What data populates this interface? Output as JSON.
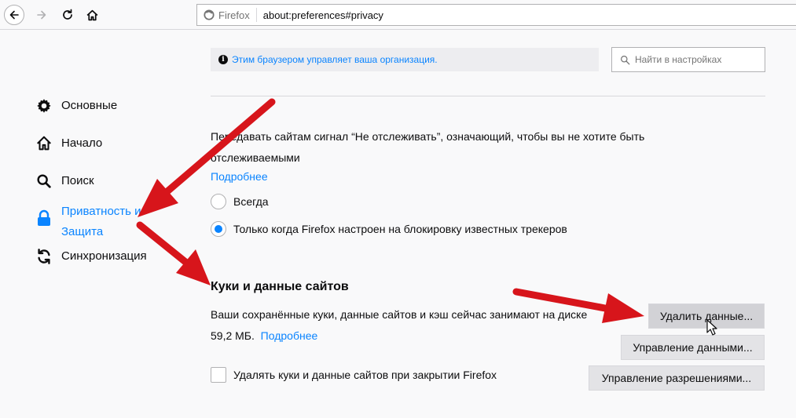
{
  "browser": {
    "identity_label": "Firefox",
    "url": "about:preferences#privacy"
  },
  "sidebar": {
    "items": [
      {
        "label": "Основные",
        "icon": "gear-icon"
      },
      {
        "label": "Начало",
        "icon": "home-icon"
      },
      {
        "label": "Поиск",
        "icon": "search-icon"
      },
      {
        "label_line1": "Приватность и",
        "label_line2": "Защита",
        "icon": "lock-icon",
        "selected": true
      },
      {
        "label": "Синхронизация",
        "icon": "sync-icon"
      }
    ]
  },
  "notice": {
    "text": "Этим браузером управляет ваша организация."
  },
  "search": {
    "placeholder": "Найти в настройках"
  },
  "dnt": {
    "text": "Передавать сайтам сигнал “Не отслеживать”, означающий, чтобы вы не хотите быть отслеживаемыми",
    "learn_more": "Подробнее",
    "options": [
      {
        "label": "Всегда",
        "checked": false
      },
      {
        "label": "Только когда Firefox настроен на блокировку известных трекеров",
        "checked": true
      }
    ]
  },
  "cookies": {
    "heading": "Куки и данные сайтов",
    "text": "Ваши сохранённые куки, данные сайтов и кэш сейчас занимают на диске 59,2 МБ.",
    "learn_more": "Подробнее",
    "clear_button": "Удалить данные...",
    "manage_button": "Управление данными...",
    "permissions_button": "Управление разрешениями...",
    "delete_on_close_label": "Удалять куки и данные сайтов при закрытии Firefox",
    "delete_on_close_checked": false
  },
  "colors": {
    "accent": "#0a84ff",
    "annotation_arrow": "#d7151b",
    "background": "#f9f9fa"
  }
}
